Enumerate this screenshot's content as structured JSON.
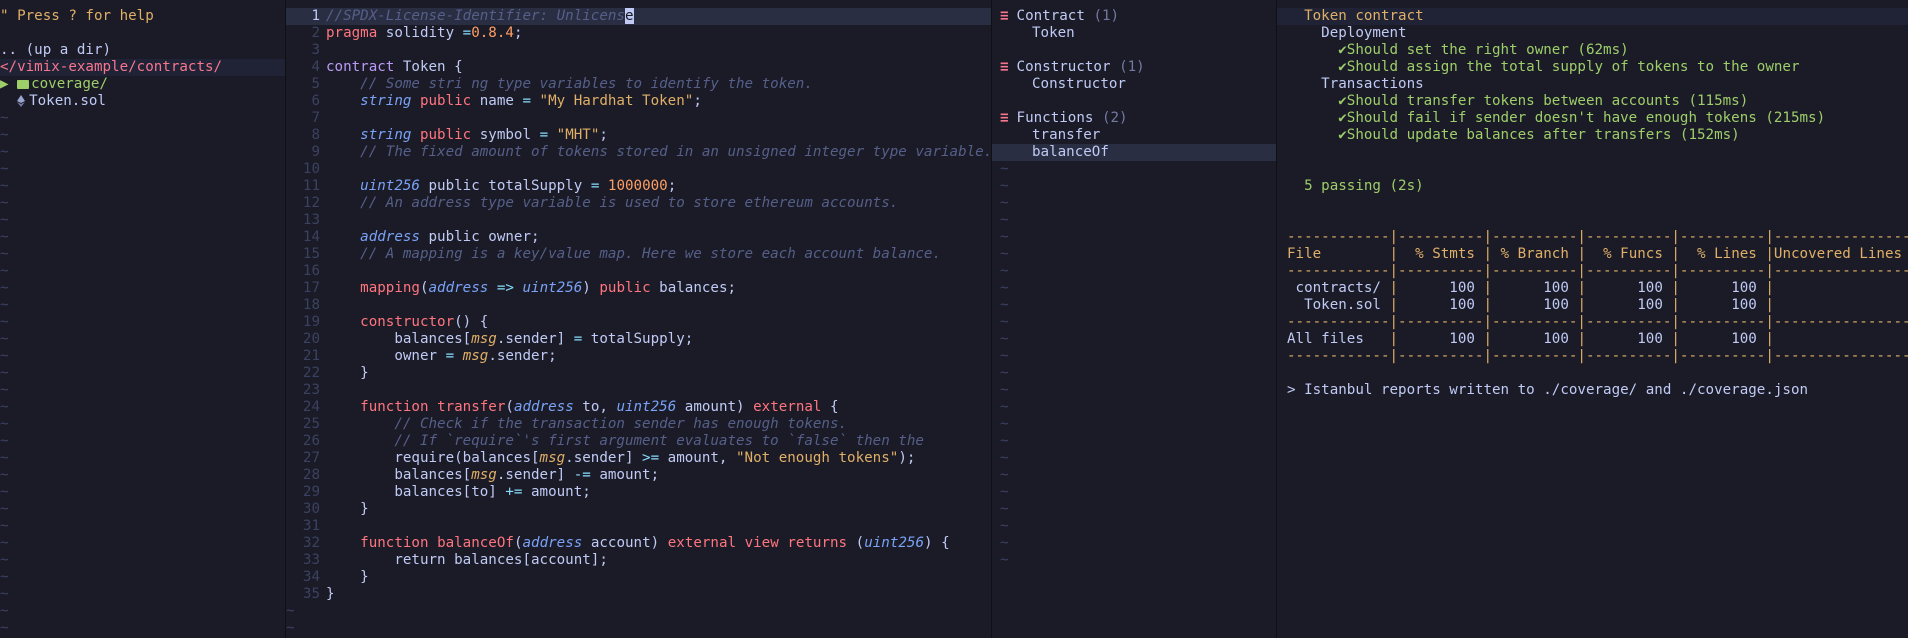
{
  "colors": {
    "background": "#1a1b26",
    "foreground": "#c0caf5",
    "comment": "#565f89",
    "keyword": "#bb9af7",
    "type": "#7aa2f7",
    "string": "#e0af68",
    "number": "#ff9e64",
    "pass": "#9ece6a",
    "error_accent": "#f7768e"
  },
  "file_tree": {
    "help": "\" Press ? for help",
    "updir": ".. (up a dir)",
    "cwd": "</vimix-example/contracts/",
    "items": [
      {
        "arrow": "▶",
        "icon": "folder-icon",
        "label": "coverage/"
      },
      {
        "icon": "ethereum-icon",
        "label": "Token.sol"
      }
    ]
  },
  "editor": {
    "cursor_char": "e",
    "lines": [
      {
        "n": "1",
        "parts": [
          [
            "cm",
            "//SPDX-License-Identifier: Unlicens"
          ],
          [
            "cursor",
            "e"
          ]
        ]
      },
      {
        "n": "2",
        "parts": [
          [
            "fn",
            "pragma"
          ],
          [
            "vr",
            " solidity "
          ],
          [
            "op",
            "="
          ],
          [
            "nu",
            "0.8.4"
          ],
          [
            "vr",
            ";"
          ]
        ]
      },
      {
        "n": "3",
        "parts": []
      },
      {
        "n": "4",
        "parts": [
          [
            "kw2",
            "contract"
          ],
          [
            "vr",
            " Token {"
          ]
        ]
      },
      {
        "n": "5",
        "parts": [
          [
            "vr",
            "    "
          ],
          [
            "cm",
            "// Some stri ng type variables to identify the token."
          ]
        ]
      },
      {
        "n": "6",
        "parts": [
          [
            "vr",
            "    "
          ],
          [
            "ty",
            "string"
          ],
          [
            "pr",
            " public"
          ],
          [
            "vr",
            " name "
          ],
          [
            "op",
            "="
          ],
          [
            "st",
            " \"My Hardhat Token\""
          ],
          [
            "vr",
            ";"
          ]
        ]
      },
      {
        "n": "7",
        "parts": []
      },
      {
        "n": "8",
        "parts": [
          [
            "vr",
            "    "
          ],
          [
            "ty",
            "string"
          ],
          [
            "pr",
            " public"
          ],
          [
            "vr",
            " symbol "
          ],
          [
            "op",
            "="
          ],
          [
            "st",
            " \"MHT\""
          ],
          [
            "vr",
            ";"
          ]
        ]
      },
      {
        "n": "9",
        "parts": [
          [
            "vr",
            "    "
          ],
          [
            "cm",
            "// The fixed amount of tokens stored in an unsigned integer type variable."
          ]
        ]
      },
      {
        "n": "10",
        "parts": []
      },
      {
        "n": "11",
        "parts": [
          [
            "vr",
            "    "
          ],
          [
            "ty",
            "uint256"
          ],
          [
            "vr",
            " public totalSupply "
          ],
          [
            "op",
            "="
          ],
          [
            "nu",
            " 1000000"
          ],
          [
            "vr",
            ";"
          ]
        ]
      },
      {
        "n": "12",
        "parts": [
          [
            "vr",
            "    "
          ],
          [
            "cm",
            "// An address type variable is used to store ethereum accounts."
          ]
        ]
      },
      {
        "n": "13",
        "parts": []
      },
      {
        "n": "14",
        "parts": [
          [
            "vr",
            "    "
          ],
          [
            "ty",
            "address"
          ],
          [
            "vr",
            " public owner;"
          ]
        ]
      },
      {
        "n": "15",
        "parts": [
          [
            "vr",
            "    "
          ],
          [
            "cm",
            "// A mapping is a key/value map. Here we store each account balance."
          ]
        ]
      },
      {
        "n": "16",
        "parts": []
      },
      {
        "n": "17",
        "parts": [
          [
            "vr",
            "    "
          ],
          [
            "fn",
            "mapping"
          ],
          [
            "vr",
            "("
          ],
          [
            "ty",
            "address"
          ],
          [
            "op",
            " =>"
          ],
          [
            "vr",
            " "
          ],
          [
            "ty",
            "uint256"
          ],
          [
            "vr",
            ")"
          ],
          [
            "pr",
            " public"
          ],
          [
            "vr",
            " balances;"
          ]
        ]
      },
      {
        "n": "18",
        "parts": []
      },
      {
        "n": "19",
        "parts": [
          [
            "vr",
            "    "
          ],
          [
            "fn",
            "constructor"
          ],
          [
            "vr",
            "() {"
          ]
        ]
      },
      {
        "n": "20",
        "parts": [
          [
            "vr",
            "        balances["
          ],
          [
            "msg",
            "msg"
          ],
          [
            "vr",
            ".sender] "
          ],
          [
            "op",
            "="
          ],
          [
            "vr",
            " totalSupply;"
          ]
        ]
      },
      {
        "n": "21",
        "parts": [
          [
            "vr",
            "        owner "
          ],
          [
            "op",
            "="
          ],
          [
            "vr",
            " "
          ],
          [
            "msg",
            "msg"
          ],
          [
            "vr",
            ".sender;"
          ]
        ]
      },
      {
        "n": "22",
        "parts": [
          [
            "vr",
            "    }"
          ]
        ]
      },
      {
        "n": "23",
        "parts": []
      },
      {
        "n": "24",
        "parts": [
          [
            "vr",
            "    "
          ],
          [
            "fn",
            "function"
          ],
          [
            "vr",
            " "
          ],
          [
            "fn",
            "transfer"
          ],
          [
            "vr",
            "("
          ],
          [
            "ty",
            "address"
          ],
          [
            "vr",
            " to, "
          ],
          [
            "ty",
            "uint256"
          ],
          [
            "vr",
            " amount) "
          ],
          [
            "pr",
            "external"
          ],
          [
            "vr",
            " {"
          ]
        ]
      },
      {
        "n": "25",
        "parts": [
          [
            "vr",
            "        "
          ],
          [
            "cm",
            "// Check if the transaction sender has enough tokens."
          ]
        ]
      },
      {
        "n": "26",
        "parts": [
          [
            "vr",
            "        "
          ],
          [
            "cm",
            "// If `require`'s first argument evaluates to `false` then the"
          ]
        ]
      },
      {
        "n": "27",
        "parts": [
          [
            "vr",
            "        require(balances["
          ],
          [
            "msg",
            "msg"
          ],
          [
            "vr",
            ".sender] "
          ],
          [
            "op",
            ">="
          ],
          [
            "vr",
            " amount, "
          ],
          [
            "st",
            "\"Not enough tokens\""
          ],
          [
            "vr",
            ");"
          ]
        ]
      },
      {
        "n": "28",
        "parts": [
          [
            "vr",
            "        balances["
          ],
          [
            "msg",
            "msg"
          ],
          [
            "vr",
            ".sender] "
          ],
          [
            "op",
            "-="
          ],
          [
            "vr",
            " amount;"
          ]
        ]
      },
      {
        "n": "29",
        "parts": [
          [
            "vr",
            "        balances[to] "
          ],
          [
            "op",
            "+="
          ],
          [
            "vr",
            " amount;"
          ]
        ]
      },
      {
        "n": "30",
        "parts": [
          [
            "vr",
            "    }"
          ]
        ]
      },
      {
        "n": "31",
        "parts": []
      },
      {
        "n": "32",
        "parts": [
          [
            "vr",
            "    "
          ],
          [
            "fn",
            "function"
          ],
          [
            "vr",
            " "
          ],
          [
            "fn",
            "balanceOf"
          ],
          [
            "vr",
            "("
          ],
          [
            "ty",
            "address"
          ],
          [
            "vr",
            " account) "
          ],
          [
            "pr",
            "external"
          ],
          [
            "vr",
            " "
          ],
          [
            "pr",
            "view"
          ],
          [
            "vr",
            " "
          ],
          [
            "pr",
            "returns"
          ],
          [
            "vr",
            " ("
          ],
          [
            "ty",
            "uint256"
          ],
          [
            "vr",
            ") {"
          ]
        ]
      },
      {
        "n": "33",
        "parts": [
          [
            "vr",
            "        return balances[account];"
          ]
        ]
      },
      {
        "n": "34",
        "parts": [
          [
            "vr",
            "    }"
          ]
        ]
      },
      {
        "n": "35",
        "parts": [
          [
            "vr",
            "}"
          ]
        ]
      }
    ]
  },
  "outline": {
    "sections": [
      {
        "title": "Contract",
        "count": "(1)",
        "items": [
          "Token"
        ]
      },
      {
        "title": "Constructor",
        "count": "(1)",
        "items": [
          "Constructor"
        ]
      },
      {
        "title": "Functions",
        "count": "(2)",
        "items": [
          "transfer",
          "balanceOf"
        ],
        "selected": "balanceOf"
      }
    ]
  },
  "terminal": {
    "title": "Token contract",
    "groups": [
      {
        "name": "Deployment",
        "tests": [
          "Should set the right owner (62ms)",
          "Should assign the total supply of tokens to the owner"
        ]
      },
      {
        "name": "Transactions",
        "tests": [
          "Should transfer tokens between accounts (115ms)",
          "Should fail if sender doesn't have enough tokens (215ms)",
          "Should update balances after transfers (152ms)"
        ]
      }
    ],
    "passing": "5 passing (2s)",
    "coverage_table": {
      "headers": [
        "File",
        "% Stmts",
        "% Branch",
        "% Funcs",
        "% Lines",
        "Uncovered Lines"
      ],
      "rows": [
        [
          "contracts/",
          "100",
          "100",
          "100",
          "100",
          ""
        ],
        [
          "Token.sol",
          "100",
          "100",
          "100",
          "100",
          ""
        ]
      ],
      "total": [
        "All files",
        "100",
        "100",
        "100",
        "100",
        ""
      ]
    },
    "output": "> Istanbul reports written to ./coverage/ and ./coverage.json"
  }
}
